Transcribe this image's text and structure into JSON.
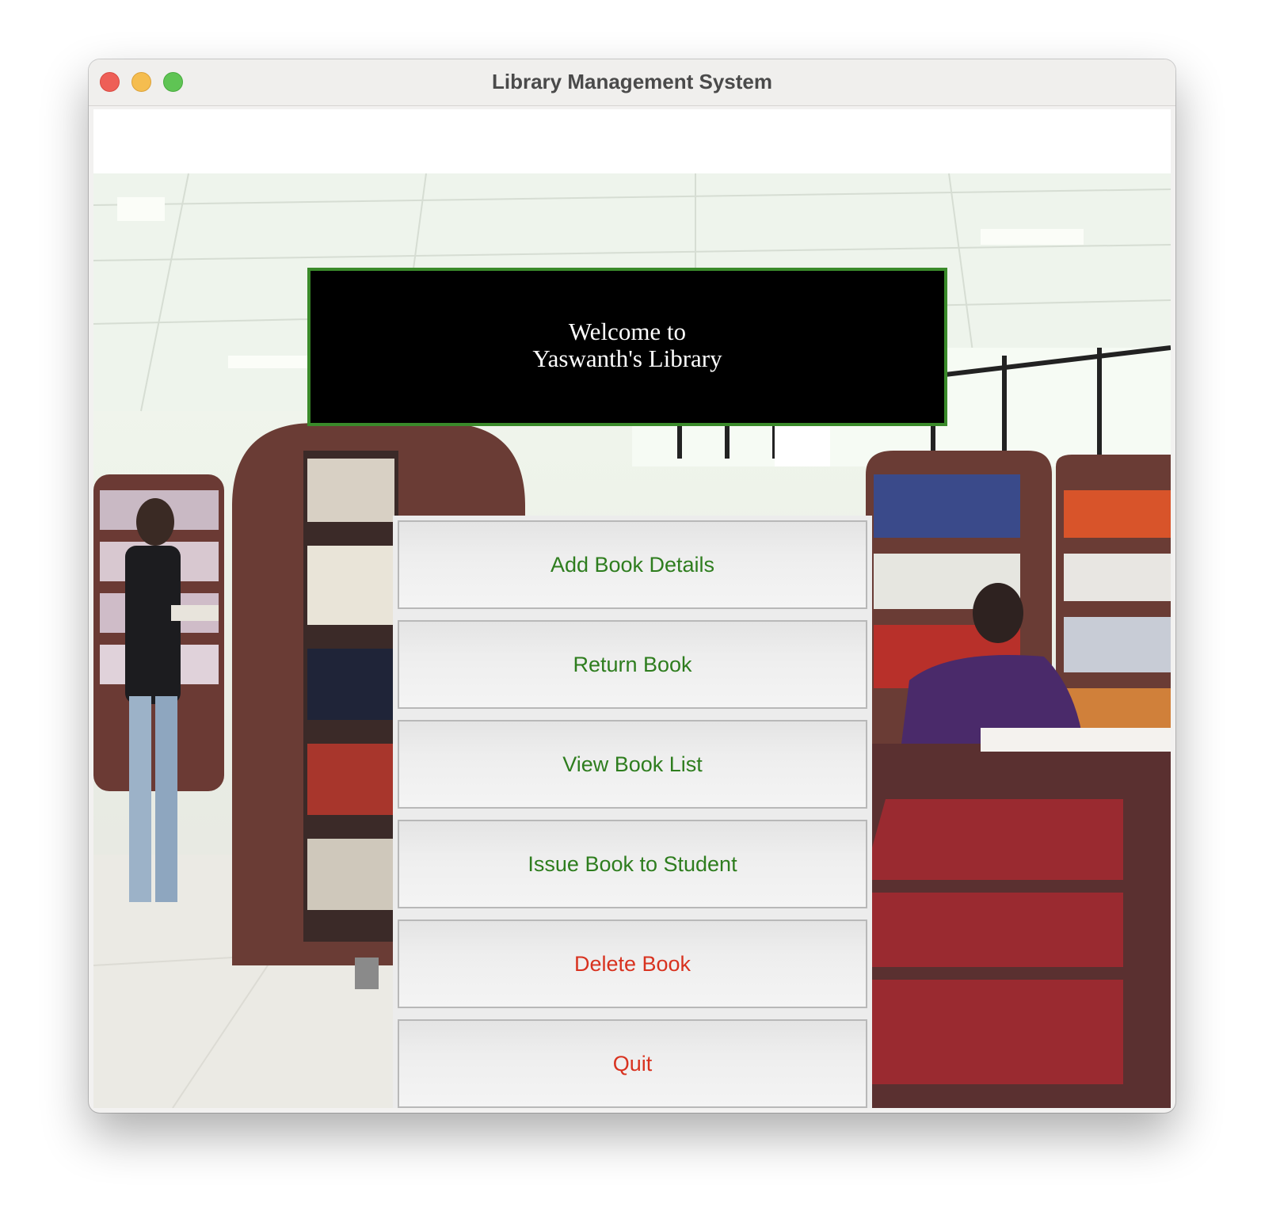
{
  "window": {
    "title": "Library Management System"
  },
  "banner": {
    "text": "Welcome to\nYaswanth's Library"
  },
  "menu": {
    "items": [
      {
        "label": "Add Book Details",
        "color": "#2e7d1e"
      },
      {
        "label": "Return Book",
        "color": "#2e7d1e"
      },
      {
        "label": "View Book List",
        "color": "#2e7d1e"
      },
      {
        "label": "Issue Book to Student",
        "color": "#2e7d1e"
      },
      {
        "label": "Delete Book",
        "color": "#d8321f"
      },
      {
        "label": "Quit",
        "color": "#d8321f"
      }
    ]
  },
  "colors": {
    "banner_background": "#000000",
    "banner_border": "#3a8a2a",
    "safe_action": "#2e7d1e",
    "destructive_action": "#d8321f"
  }
}
